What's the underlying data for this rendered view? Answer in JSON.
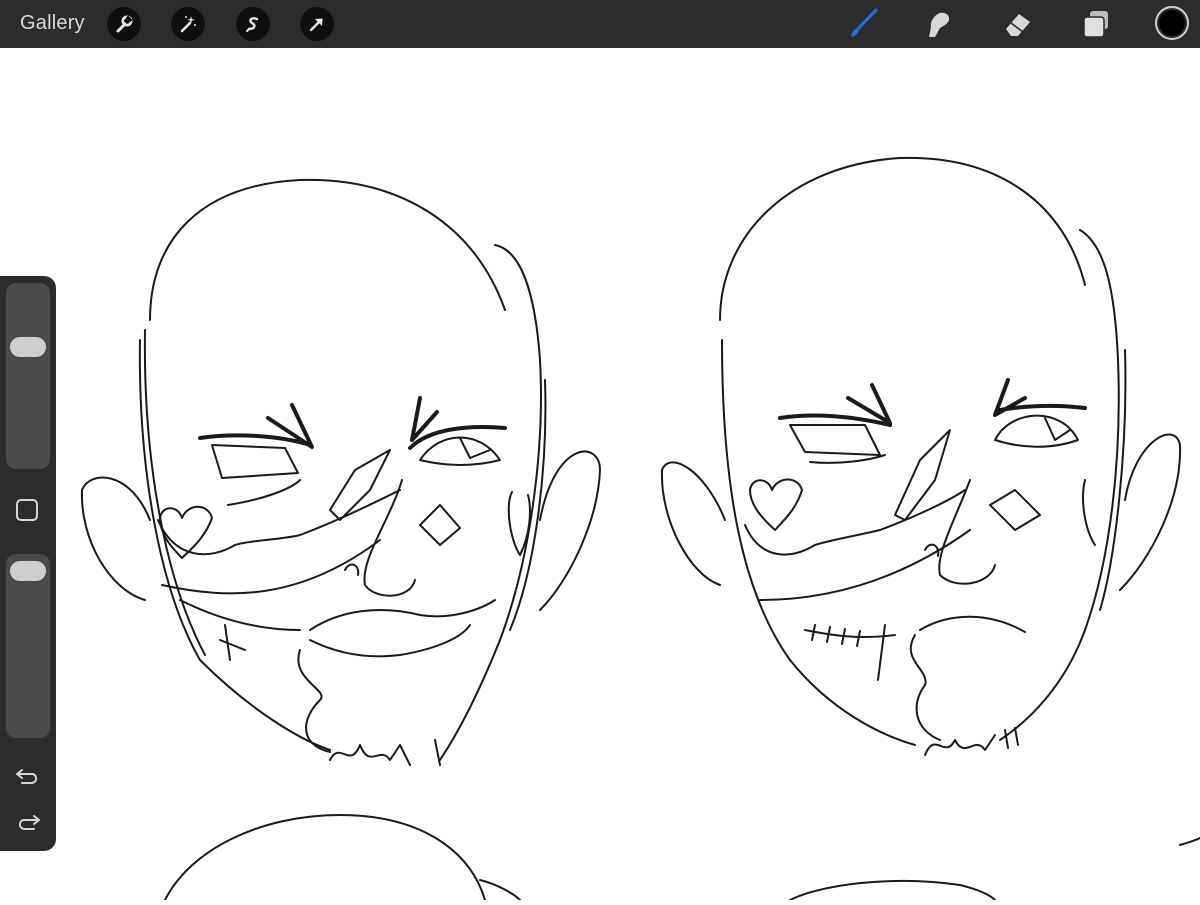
{
  "topbar": {
    "gallery_label": "Gallery",
    "left_tools": [
      {
        "name": "wrench-icon"
      },
      {
        "name": "magic-wand-icon"
      },
      {
        "name": "selection-icon"
      },
      {
        "name": "transform-arrow-icon"
      }
    ],
    "right_tools": [
      {
        "name": "brush-icon",
        "active": true
      },
      {
        "name": "smudge-icon",
        "active": false
      },
      {
        "name": "eraser-icon",
        "active": false
      },
      {
        "name": "layers-icon",
        "active": false
      }
    ],
    "current_color": "#000000",
    "active_tool_color": "#1e6fd9"
  },
  "sidebar": {
    "brush_size": 0.68,
    "brush_opacity": 0.97,
    "modify_button": "square-icon",
    "undo_icon": "undo-icon",
    "redo_icon": "redo-icon"
  }
}
